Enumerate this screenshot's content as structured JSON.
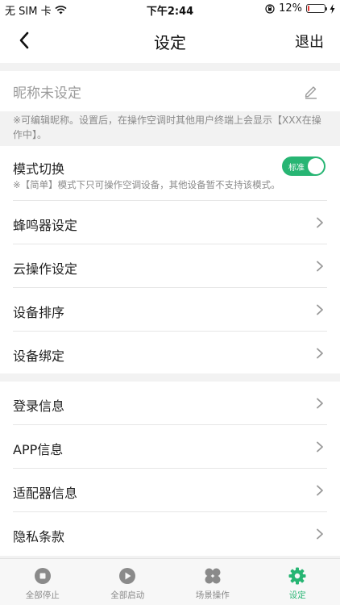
{
  "status_bar": {
    "carrier": "无 SIM 卡",
    "time": "下午2:44",
    "battery_percent": "12%",
    "battery_level": 0.12
  },
  "nav": {
    "title": "设定",
    "logout_label": "退出"
  },
  "nickname": {
    "placeholder": "昵称未设定",
    "hint": "※可编辑昵称。设置后，在操作空调时其他用户终端上会显示【XXX在操作中】。"
  },
  "mode_switch": {
    "title": "模式切换",
    "toggle_label": "标准",
    "description": "※【简单】模式下只可操作空调设备，其他设备暂不支持该模式。"
  },
  "group1": [
    {
      "label": "蜂鸣器设定"
    },
    {
      "label": "云操作设定"
    },
    {
      "label": "设备排序"
    },
    {
      "label": "设备绑定"
    }
  ],
  "group2": [
    {
      "label": "登录信息"
    },
    {
      "label": "APP信息"
    },
    {
      "label": "适配器信息"
    },
    {
      "label": "隐私条款"
    }
  ],
  "tabs": [
    {
      "label": "全部停止",
      "icon": "stop-icon"
    },
    {
      "label": "全部启动",
      "icon": "play-icon"
    },
    {
      "label": "场景操作",
      "icon": "scene-icon"
    },
    {
      "label": "设定",
      "icon": "gear-icon"
    }
  ],
  "colors": {
    "accent": "#27b573",
    "battery_low": "#e53935",
    "tab_inactive": "#8a8a8a"
  }
}
